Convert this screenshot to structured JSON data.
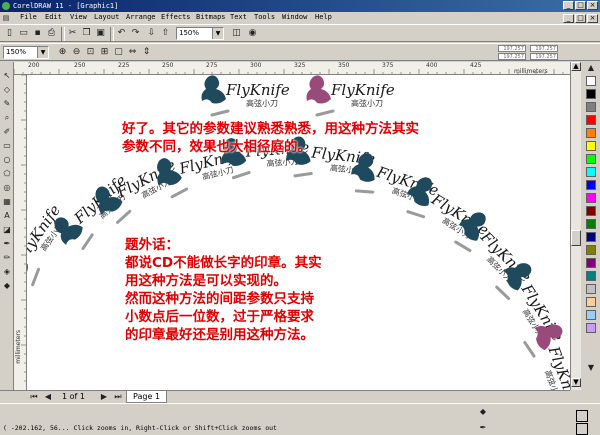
{
  "window": {
    "title": "CorelDRAW 11 - [Graphic1]"
  },
  "menu": [
    "File",
    "Edit",
    "View",
    "Layout",
    "Arrange",
    "Effects",
    "Bitmaps",
    "Text",
    "Tools",
    "Window",
    "Help"
  ],
  "toolbar": {
    "zoom_value": "150%"
  },
  "propertybar": {
    "zoom_value": "150%",
    "nudge_x": "197.257",
    "nudge_y": "197.257",
    "dup_x": "197.257",
    "dup_y": "197.257"
  },
  "ruler": {
    "unit": "millimeters",
    "h_ticks": [
      "200",
      "250",
      "225",
      "250",
      "275",
      "300",
      "325",
      "350",
      "375",
      "400",
      "425"
    ]
  },
  "logo": {
    "brand": "FlyKnife",
    "sub": "高弦小刀"
  },
  "annotations": {
    "line1": "好了。其它的参数建议熟悉熟悉，用这种方法其实",
    "line2": "参数不同，效果也大相径庭的。",
    "block2": [
      "题外话：",
      "都说CD不能做长字的印章。其实",
      "用这种方法是可以实现的。",
      "然而这种方法的间距参数只支持",
      "小数点后一位数，过于严格要求",
      "的印章最好还是别用这种方法。"
    ]
  },
  "pagebar": {
    "page_count": "1 of 1",
    "page_tab": "Page 1"
  },
  "status": {
    "text": "( -202.162, 56... Click zooms in, Right-Click or Shift+Click zooms out"
  },
  "colors": {
    "accent": "#0a246a",
    "logo_dark": "#1f4a5e",
    "logo_magenta": "#9a4a7a",
    "annotation": "#e00000"
  },
  "palette": [
    "#ffffff",
    "#000000",
    "#7f7f7f",
    "#ff0000",
    "#ff8000",
    "#ffff00",
    "#00ff00",
    "#00ffff",
    "#0000ff",
    "#ff00ff",
    "#800000",
    "#008000",
    "#000080",
    "#808000",
    "#800080",
    "#008080",
    "#c0c0c0",
    "#ffcc99",
    "#99ccff",
    "#cc99ff"
  ]
}
